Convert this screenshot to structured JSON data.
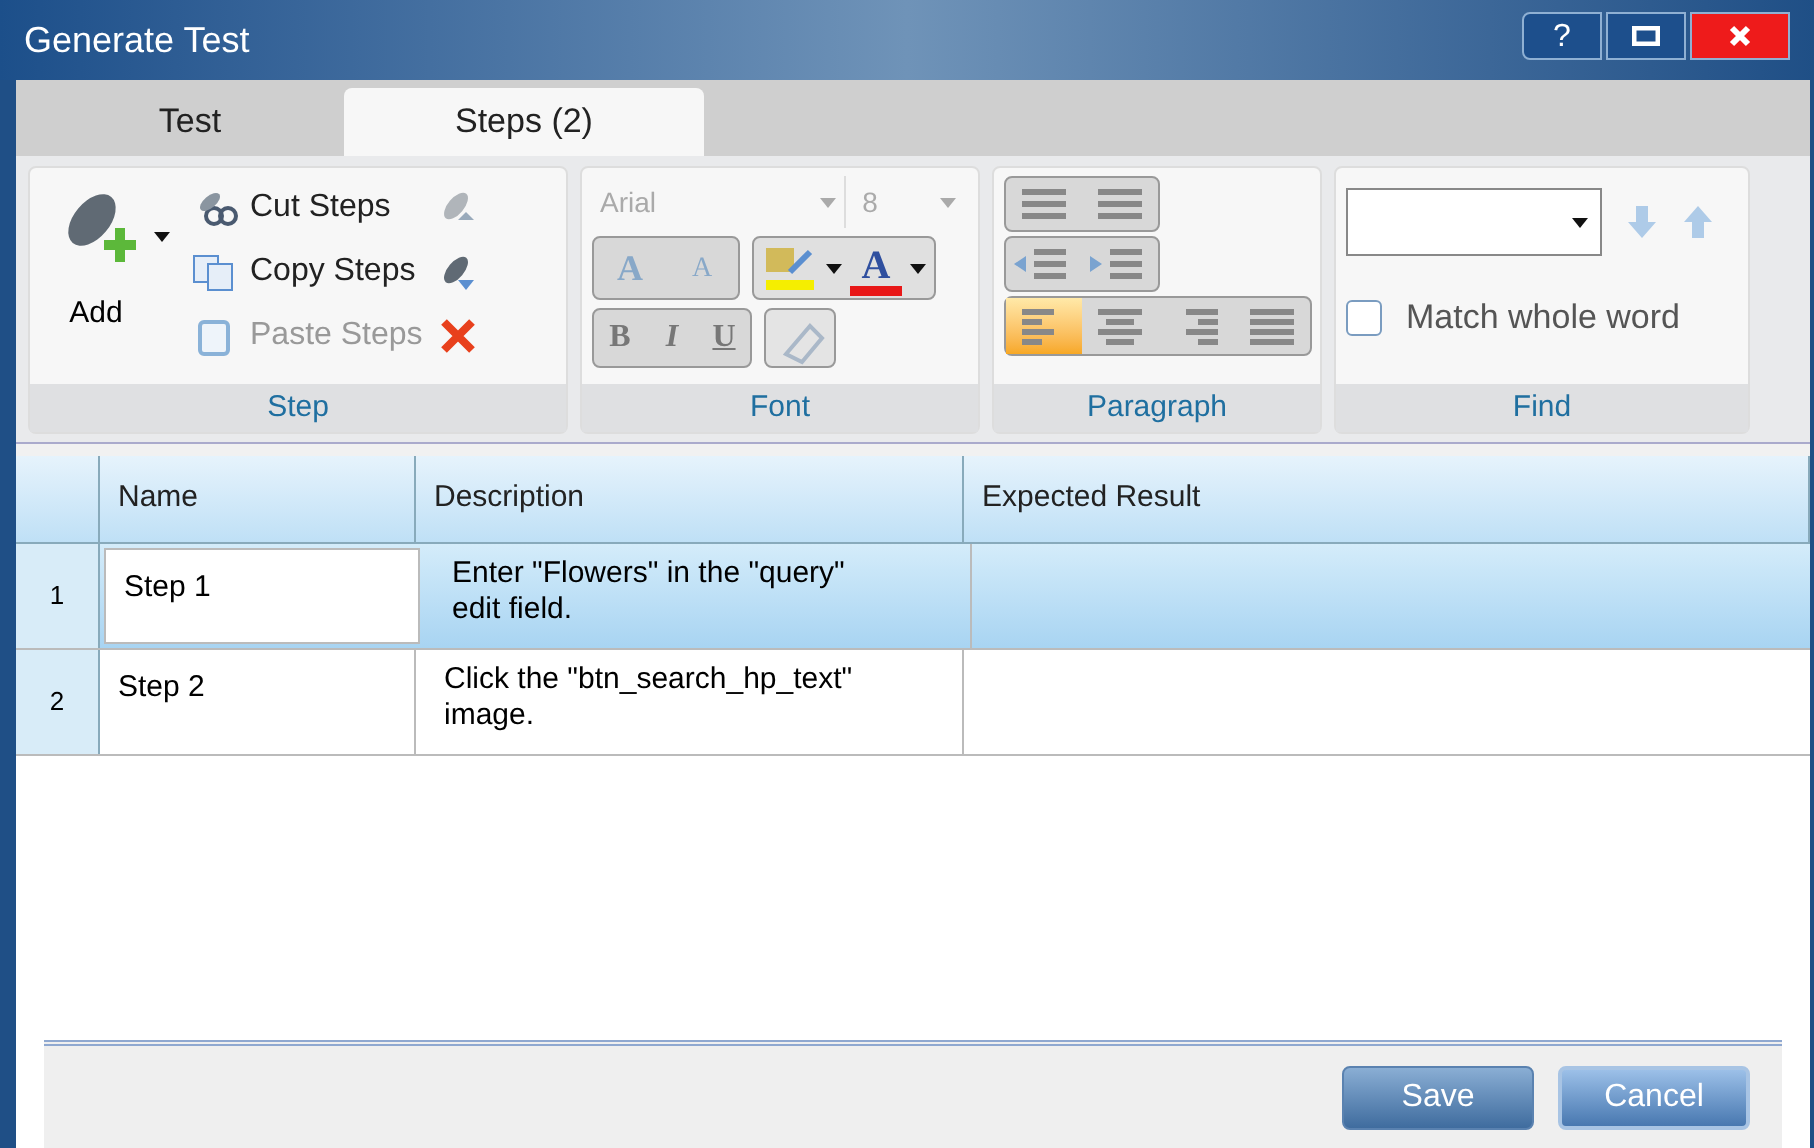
{
  "window": {
    "title": "Generate Test",
    "help": "?"
  },
  "tabs": [
    {
      "label": "Test",
      "selected": false
    },
    {
      "label": "Steps (2)",
      "selected": true
    }
  ],
  "ribbon": {
    "step": {
      "label": "Step",
      "add": "Add",
      "actions": [
        {
          "label": "Cut Steps",
          "disabled": false
        },
        {
          "label": "Copy Steps",
          "disabled": false
        },
        {
          "label": "Paste Steps",
          "disabled": true
        }
      ]
    },
    "font": {
      "label": "Font",
      "font_name": "Arial",
      "font_size": "8",
      "disabled": true,
      "grow": "A",
      "shrink": "A",
      "text_color_button": "A",
      "bold": "B",
      "italic": "I",
      "underline": "U"
    },
    "paragraph": {
      "label": "Paragraph",
      "alignments": [
        {
          "selected": true
        },
        {
          "selected": false
        },
        {
          "selected": false
        },
        {
          "selected": false
        }
      ]
    },
    "find": {
      "label": "Find",
      "match_whole_word": {
        "label": "Match whole word",
        "checked": false
      }
    }
  },
  "table": {
    "columns": [
      "Name",
      "Description",
      "Expected Result"
    ],
    "rows": [
      {
        "number": "1",
        "name": "Step 1",
        "description": "Enter \"Flowers\" in the \"query\" edit field.",
        "selected": true
      },
      {
        "number": "2",
        "name": "Step 2",
        "description": "Click the \"btn_search_hp_text\" image.",
        "selected": false
      }
    ]
  },
  "buttons": [
    "Save",
    "Cancel"
  ]
}
